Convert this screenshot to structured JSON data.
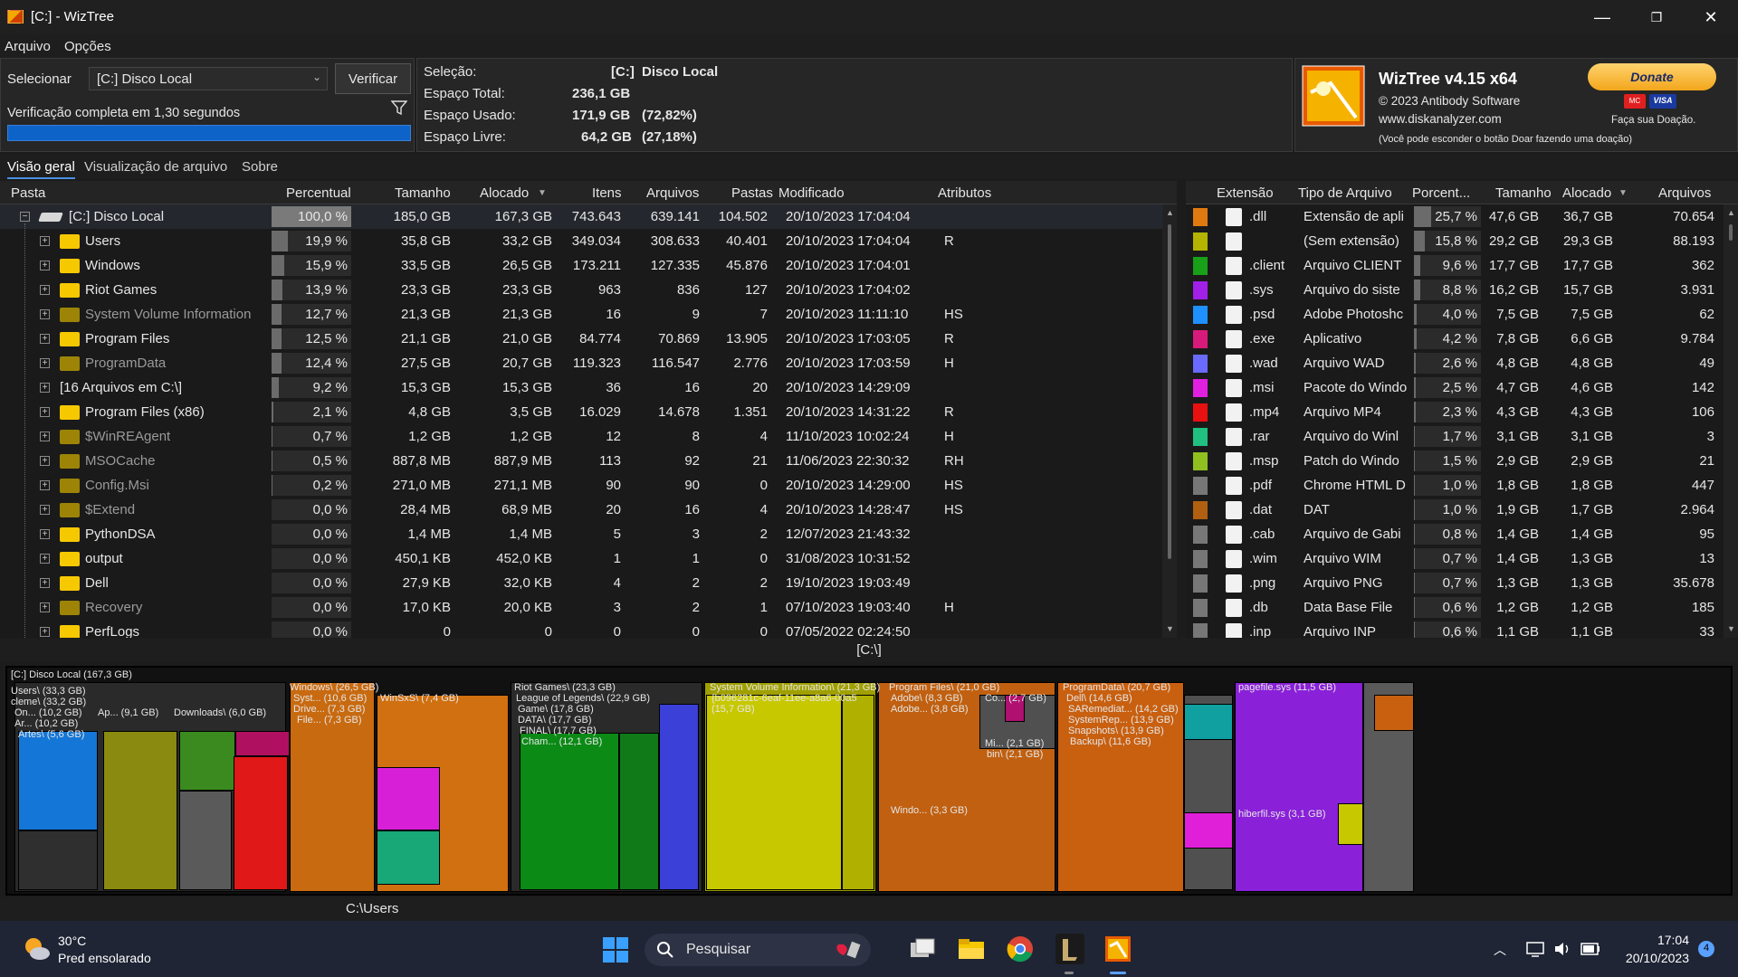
{
  "window": {
    "title": "[C:]  - WizTree",
    "minimize": "—",
    "maximize": "❐",
    "close": "✕"
  },
  "menu": [
    "Arquivo",
    "Opções"
  ],
  "select": {
    "label": "Selecionar",
    "drive": "[C:] Disco Local",
    "verify": "Verificar",
    "status": "Verificação completa em 1,30 segundos",
    "progress": 1.0
  },
  "info": {
    "sel_label": "Seleção:",
    "sel_val": "[C:]",
    "sel_name": "Disco Local",
    "total_label": "Espaço Total:",
    "total_val": "236,1 GB",
    "used_label": "Espaço Usado:",
    "used_val": "171,9 GB",
    "used_pct": "(72,82%)",
    "free_label": "Espaço Livre:",
    "free_val": "64,2 GB",
    "free_pct": "(27,18%)"
  },
  "about": {
    "name": "WizTree v4.15 x64",
    "copy": "© 2023 Antibody Software",
    "url": "www.diskanalyzer.com",
    "donate": "Donate",
    "donate_note": "Faça sua Doação.",
    "hide_note": "(Você pode esconder o botão Doar fazendo uma doação)",
    "card1": "MC",
    "card2": "VISA"
  },
  "tabs": [
    "Visão geral",
    "Visualização de arquivo",
    "Sobre"
  ],
  "left_headers": [
    "Pasta",
    "Percentual",
    "Tamanho",
    "Alocado",
    "Itens",
    "Arquivos",
    "Pastas",
    "Modificado",
    "Atributos"
  ],
  "root": {
    "name": "[C:] Disco Local",
    "pct": "100,0 %",
    "pctv": 1.0,
    "size": "185,0 GB",
    "alloc": "167,3 GB",
    "items": "743.643",
    "files": "639.141",
    "folders": "104.502",
    "mod": "20/10/2023 17:04:04",
    "attr": ""
  },
  "rows": [
    {
      "name": "Users",
      "pct": "19,9 %",
      "pctv": 0.199,
      "size": "35,8 GB",
      "alloc": "33,2 GB",
      "items": "349.034",
      "files": "308.633",
      "folders": "40.401",
      "mod": "20/10/2023 17:04:04",
      "attr": "R",
      "sys": false,
      "gear": false
    },
    {
      "name": "Windows",
      "pct": "15,9 %",
      "pctv": 0.159,
      "size": "33,5 GB",
      "alloc": "26,5 GB",
      "items": "173.211",
      "files": "127.335",
      "folders": "45.876",
      "mod": "20/10/2023 17:04:01",
      "attr": "",
      "sys": false,
      "gear": false
    },
    {
      "name": "Riot Games",
      "pct": "13,9 %",
      "pctv": 0.139,
      "size": "23,3 GB",
      "alloc": "23,3 GB",
      "items": "963",
      "files": "836",
      "folders": "127",
      "mod": "20/10/2023 17:04:02",
      "attr": "",
      "sys": false,
      "gear": false
    },
    {
      "name": "System Volume Information",
      "pct": "12,7 %",
      "pctv": 0.127,
      "size": "21,3 GB",
      "alloc": "21,3 GB",
      "items": "16",
      "files": "9",
      "folders": "7",
      "mod": "20/10/2023 11:11:10",
      "attr": "HS",
      "sys": true,
      "gear": true
    },
    {
      "name": "Program Files",
      "pct": "12,5 %",
      "pctv": 0.125,
      "size": "21,1 GB",
      "alloc": "21,0 GB",
      "items": "84.774",
      "files": "70.869",
      "folders": "13.905",
      "mod": "20/10/2023 17:03:05",
      "attr": "R",
      "sys": false,
      "gear": false
    },
    {
      "name": "ProgramData",
      "pct": "12,4 %",
      "pctv": 0.124,
      "size": "27,5 GB",
      "alloc": "20,7 GB",
      "items": "119.323",
      "files": "116.547",
      "folders": "2.776",
      "mod": "20/10/2023 17:03:59",
      "attr": "H",
      "sys": true,
      "gear": false
    },
    {
      "name": "[16 Arquivos em C:\\]",
      "pct": "9,2 %",
      "pctv": 0.092,
      "size": "15,3 GB",
      "alloc": "15,3 GB",
      "items": "36",
      "files": "16",
      "folders": "20",
      "mod": "20/10/2023 14:29:09",
      "attr": "",
      "sys": false,
      "gear": false,
      "nofolder": true
    },
    {
      "name": "Program Files (x86)",
      "pct": "2,1 %",
      "pctv": 0.021,
      "size": "4,8 GB",
      "alloc": "3,5 GB",
      "items": "16.029",
      "files": "14.678",
      "folders": "1.351",
      "mod": "20/10/2023 14:31:22",
      "attr": "R",
      "sys": false,
      "gear": false
    },
    {
      "name": "$WinREAgent",
      "pct": "0,7 %",
      "pctv": 0.007,
      "size": "1,2 GB",
      "alloc": "1,2 GB",
      "items": "12",
      "files": "8",
      "folders": "4",
      "mod": "11/10/2023 10:02:24",
      "attr": "H",
      "sys": true,
      "gear": false
    },
    {
      "name": "MSOCache",
      "pct": "0,5 %",
      "pctv": 0.005,
      "size": "887,8 MB",
      "alloc": "887,9 MB",
      "items": "113",
      "files": "92",
      "folders": "21",
      "mod": "11/06/2023 22:30:32",
      "attr": "RH",
      "sys": true,
      "gear": false
    },
    {
      "name": "Config.Msi",
      "pct": "0,2 %",
      "pctv": 0.002,
      "size": "271,0 MB",
      "alloc": "271,1 MB",
      "items": "90",
      "files": "90",
      "folders": "0",
      "mod": "20/10/2023 14:29:00",
      "attr": "HS",
      "sys": true,
      "gear": true
    },
    {
      "name": "$Extend",
      "pct": "0,0 %",
      "pctv": 0.0,
      "size": "28,4 MB",
      "alloc": "68,9 MB",
      "items": "20",
      "files": "16",
      "folders": "4",
      "mod": "20/10/2023 14:28:47",
      "attr": "HS",
      "sys": true,
      "gear": true
    },
    {
      "name": "PythonDSA",
      "pct": "0,0 %",
      "pctv": 0.0,
      "size": "1,4 MB",
      "alloc": "1,4 MB",
      "items": "5",
      "files": "3",
      "folders": "2",
      "mod": "12/07/2023 21:43:32",
      "attr": "",
      "sys": false,
      "gear": false
    },
    {
      "name": "output",
      "pct": "0,0 %",
      "pctv": 0.0,
      "size": "450,1 KB",
      "alloc": "452,0 KB",
      "items": "1",
      "files": "1",
      "folders": "0",
      "mod": "31/08/2023 10:31:52",
      "attr": "",
      "sys": false,
      "gear": false
    },
    {
      "name": "Dell",
      "pct": "0,0 %",
      "pctv": 0.0,
      "size": "27,9 KB",
      "alloc": "32,0 KB",
      "items": "4",
      "files": "2",
      "folders": "2",
      "mod": "19/10/2023 19:03:49",
      "attr": "",
      "sys": false,
      "gear": false
    },
    {
      "name": "Recovery",
      "pct": "0,0 %",
      "pctv": 0.0,
      "size": "17,0 KB",
      "alloc": "20,0 KB",
      "items": "3",
      "files": "2",
      "folders": "1",
      "mod": "07/10/2023 19:03:40",
      "attr": "H",
      "sys": true,
      "gear": false
    },
    {
      "name": "PerfLogs",
      "pct": "0,0 %",
      "pctv": 0.0,
      "size": "0",
      "alloc": "0",
      "items": "0",
      "files": "0",
      "folders": "0",
      "mod": "07/05/2022 02:24:50",
      "attr": "",
      "sys": false,
      "gear": false
    }
  ],
  "right_headers": [
    "Extensão",
    "Tipo de Arquivo",
    "Porcent...",
    "Tamanho",
    "Alocado",
    "Arquivos"
  ],
  "ext": [
    {
      "ext": ".dll",
      "type": "Extensão de apli",
      "pct": "25,7 %",
      "pctv": 0.257,
      "size": "47,6 GB",
      "alloc": "36,7 GB",
      "files": "70.654",
      "color": "#e07a10"
    },
    {
      "ext": "",
      "type": "(Sem extensão)",
      "pct": "15,8 %",
      "pctv": 0.158,
      "size": "29,2 GB",
      "alloc": "29,3 GB",
      "files": "88.193",
      "color": "#b4b400"
    },
    {
      "ext": ".client",
      "type": "Arquivo CLIENT",
      "pct": "9,6 %",
      "pctv": 0.096,
      "size": "17,7 GB",
      "alloc": "17,7 GB",
      "files": "362",
      "color": "#18a018"
    },
    {
      "ext": ".sys",
      "type": "Arquivo do siste",
      "pct": "8,8 %",
      "pctv": 0.088,
      "size": "16,2 GB",
      "alloc": "15,7 GB",
      "files": "3.931",
      "color": "#a020e8"
    },
    {
      "ext": ".psd",
      "type": "Adobe Photoshc",
      "pct": "4,0 %",
      "pctv": 0.04,
      "size": "7,5 GB",
      "alloc": "7,5 GB",
      "files": "62",
      "color": "#1e90ff"
    },
    {
      "ext": ".exe",
      "type": "Aplicativo",
      "pct": "4,2 %",
      "pctv": 0.042,
      "size": "7,8 GB",
      "alloc": "6,6 GB",
      "files": "9.784",
      "color": "#d81b7a"
    },
    {
      "ext": ".wad",
      "type": "Arquivo WAD",
      "pct": "2,6 %",
      "pctv": 0.026,
      "size": "4,8 GB",
      "alloc": "4,8 GB",
      "files": "49",
      "color": "#6a6aff"
    },
    {
      "ext": ".msi",
      "type": "Pacote do Windo",
      "pct": "2,5 %",
      "pctv": 0.025,
      "size": "4,7 GB",
      "alloc": "4,6 GB",
      "files": "142",
      "color": "#e020e0"
    },
    {
      "ext": ".mp4",
      "type": "Arquivo MP4",
      "pct": "2,3 %",
      "pctv": 0.023,
      "size": "4,3 GB",
      "alloc": "4,3 GB",
      "files": "106",
      "color": "#e81010"
    },
    {
      "ext": ".rar",
      "type": "Arquivo do Winl",
      "pct": "1,7 %",
      "pctv": 0.017,
      "size": "3,1 GB",
      "alloc": "3,1 GB",
      "files": "3",
      "color": "#20c080"
    },
    {
      "ext": ".msp",
      "type": "Patch do Windo",
      "pct": "1,5 %",
      "pctv": 0.015,
      "size": "2,9 GB",
      "alloc": "2,9 GB",
      "files": "21",
      "color": "#90c020"
    },
    {
      "ext": ".pdf",
      "type": "Chrome HTML D",
      "pct": "1,0 %",
      "pctv": 0.01,
      "size": "1,8 GB",
      "alloc": "1,8 GB",
      "files": "447",
      "color": "#777777"
    },
    {
      "ext": ".dat",
      "type": "DAT",
      "pct": "1,0 %",
      "pctv": 0.01,
      "size": "1,9 GB",
      "alloc": "1,7 GB",
      "files": "2.964",
      "color": "#b06010"
    },
    {
      "ext": ".cab",
      "type": "Arquivo de Gabi",
      "pct": "0,8 %",
      "pctv": 0.008,
      "size": "1,4 GB",
      "alloc": "1,4 GB",
      "files": "95",
      "color": "#777777"
    },
    {
      "ext": ".wim",
      "type": "Arquivo WIM",
      "pct": "0,7 %",
      "pctv": 0.007,
      "size": "1,4 GB",
      "alloc": "1,3 GB",
      "files": "13",
      "color": "#777777"
    },
    {
      "ext": ".png",
      "type": "Arquivo PNG",
      "pct": "0,7 %",
      "pctv": 0.007,
      "size": "1,3 GB",
      "alloc": "1,3 GB",
      "files": "35.678",
      "color": "#777777"
    },
    {
      "ext": ".db",
      "type": "Data Base File",
      "pct": "0,6 %",
      "pctv": 0.006,
      "size": "1,2 GB",
      "alloc": "1,2 GB",
      "files": "185",
      "color": "#777777"
    },
    {
      "ext": ".inp",
      "type": "Arquivo INP",
      "pct": "0,6 %",
      "pctv": 0.006,
      "size": "1,1 GB",
      "alloc": "1,1 GB",
      "files": "33",
      "color": "#777777"
    }
  ],
  "path": "[C:\\]",
  "status_path": "C:\\Users",
  "treemap": {
    "root": "[C:] Disco Local (167,3 GB)",
    "labels": [
      "Users\\ (33,3 GB)",
      "cleme\\ (33,2 GB)",
      "On... (10,2 GB)",
      "Ar... (10,2 GB)",
      "Artes\\ (5,6 GB)",
      "Ap... (9,1 GB)",
      "Downloads\\ (6,0 GB)",
      "Windows\\ (26,5 GB)",
      "Syst... (10,6 GB)",
      "Drive... (7,3 GB)",
      "File... (7,3 GB)",
      "WinSxS\\ (7,4 GB)",
      "Riot Games\\ (23,3 GB)",
      "League of Legends\\ (22,9 GB)",
      "Game\\ (17,8 GB)",
      "DATA\\ (17,7 GB)",
      "FINAL\\ (17,7 GB)",
      "Cham... (12,1 GB)",
      "System Volume Information\\ (21,3 GB)",
      "{b096281c-6eaf-11ee-a8a6-00a5",
      "(15,7 GB)",
      "Program Files\\ (21,0 GB)",
      "Adobe\\ (8,3 GB)",
      "Adobe... (3,8 GB)",
      "Co... (2,7 GB)",
      "Mi... (2,1 GB)",
      "bin\\ (2,1 GB)",
      "Windo... (3,3 GB)",
      "ProgramData\\ (20,7 GB)",
      "Dell\\ (14,6 GB)",
      "SARemediat... (14,2 GB)",
      "SystemRep... (13,9 GB)",
      "Snapshots\\ (13,9 GB)",
      "Backup\\ (11,6 GB)",
      "pagefile.sys (11,5 GB)",
      "hiberfil.sys (3,1 GB)"
    ]
  },
  "taskbar": {
    "temp": "30°C",
    "weather": "Pred ensolarado",
    "search": "Pesquisar",
    "time": "17:04",
    "date": "20/10/2023",
    "badge": "4"
  }
}
